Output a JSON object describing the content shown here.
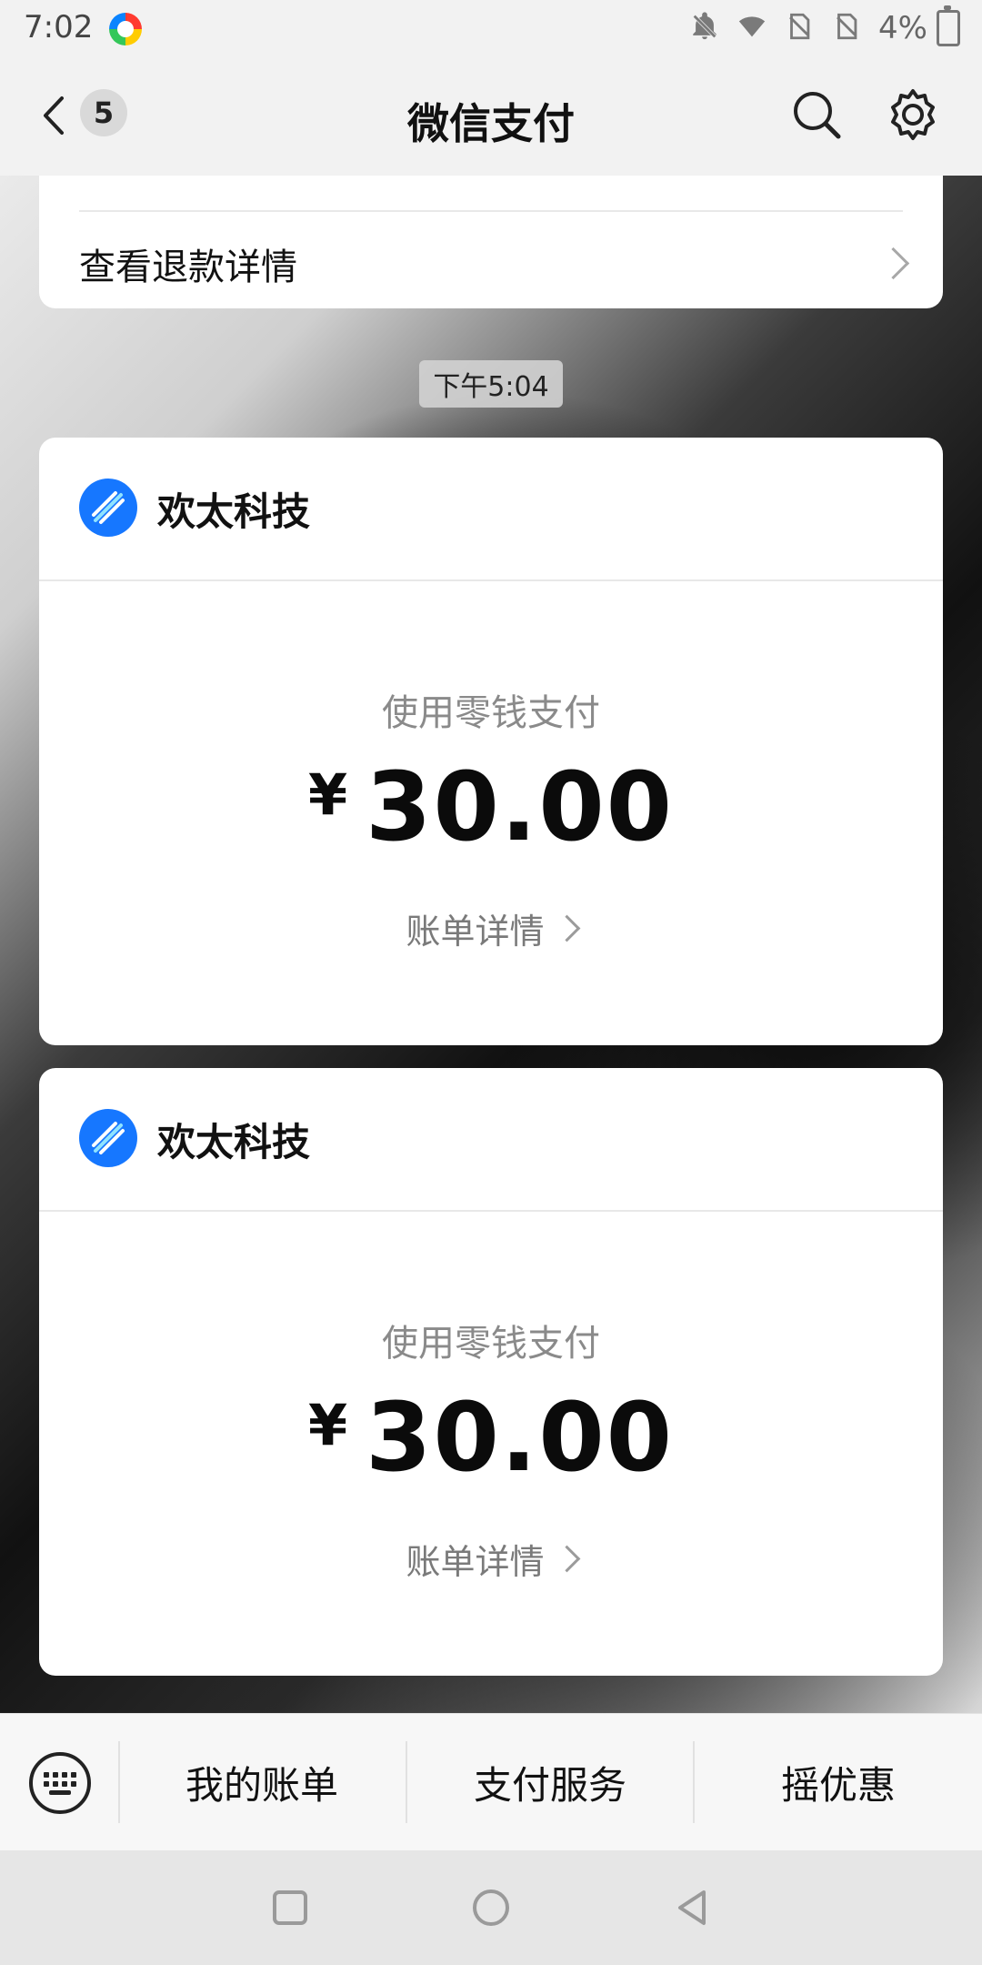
{
  "status_bar": {
    "time": "7:02",
    "battery": "4%"
  },
  "nav": {
    "title": "微信支付",
    "badge": "5"
  },
  "refund": {
    "label": "查看退款详情"
  },
  "time_chip": "下午5:04",
  "payments": [
    {
      "merchant": "欢太科技",
      "method": "使用零钱支付",
      "currency": "¥",
      "amount": "30.00",
      "details_label": "账单详情"
    },
    {
      "merchant": "欢太科技",
      "method": "使用零钱支付",
      "currency": "¥",
      "amount": "30.00",
      "details_label": "账单详情"
    }
  ],
  "bottom_menu": {
    "items": [
      "我的账单",
      "支付服务",
      "摇优惠"
    ]
  },
  "colors": {
    "merchant_logo": "#1677ff"
  },
  "icons": [
    "back-icon",
    "search-icon",
    "gear-icon",
    "keyboard-icon",
    "chevron-right-icon",
    "square-nav-icon",
    "circle-nav-icon",
    "back-triangle-nav-icon"
  ]
}
